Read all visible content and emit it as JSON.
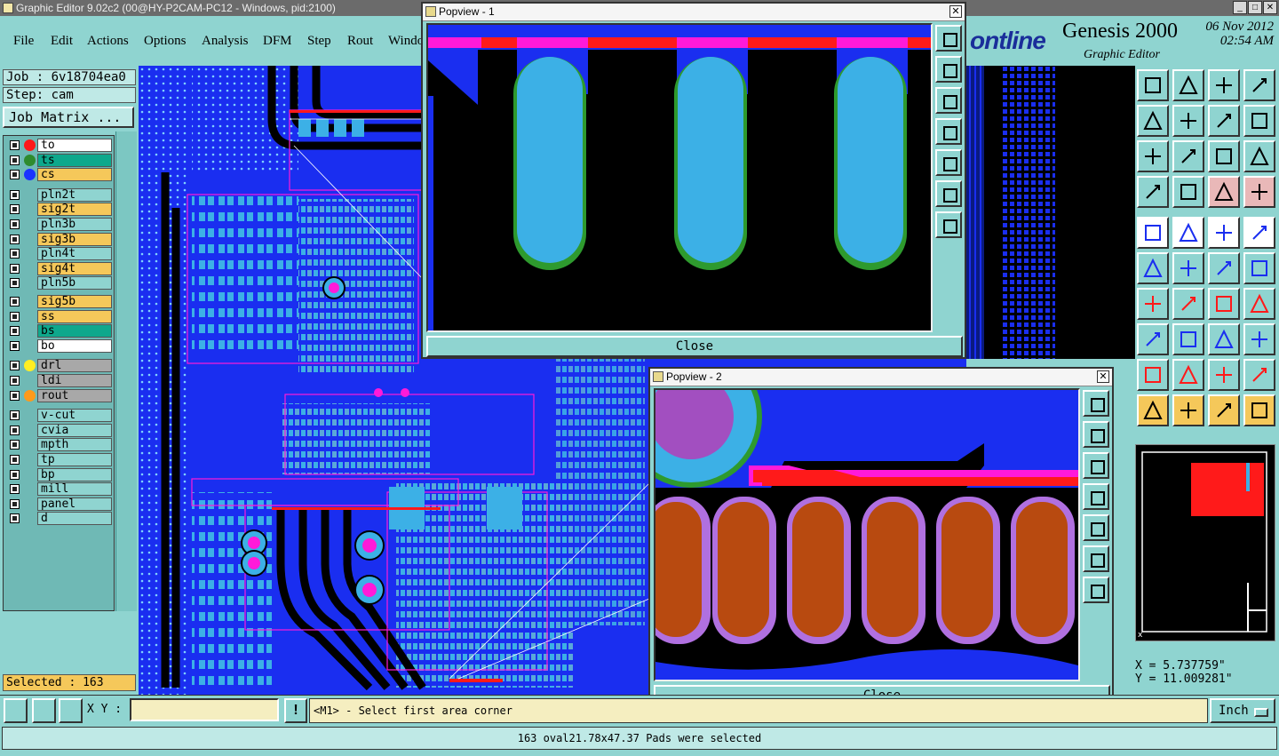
{
  "window": {
    "title": "Graphic Editor 9.02c2 (00@HY-P2CAM-PC12 - Windows, pid:2100)",
    "controls": [
      "_",
      "□",
      "✕"
    ]
  },
  "menu": [
    "File",
    "Edit",
    "Actions",
    "Options",
    "Analysis",
    "DFM",
    "Step",
    "Rout",
    "Windo"
  ],
  "brand": {
    "logo": "ontline",
    "product": "Genesis 2000",
    "date": "06 Nov 2012",
    "time": "02:54 AM",
    "subtitle": "Graphic Editor"
  },
  "job": {
    "job_label": "Job : 6v18704ea0",
    "step_label": "Step: cam",
    "matrix_button": "Job Matrix ..."
  },
  "layers": [
    {
      "name": "to",
      "color": "#ffffff",
      "dot": "#ff1a1a"
    },
    {
      "name": "ts",
      "color": "#0ea88c",
      "dot": "#2e8b2e"
    },
    {
      "name": "cs",
      "color": "#f5c85a",
      "dot": "#1a33ff"
    },
    {
      "name": "pln2t",
      "color": "#8fd4d0",
      "dot": ""
    },
    {
      "name": "sig2t",
      "color": "#f5c85a",
      "dot": ""
    },
    {
      "name": "pln3b",
      "color": "#8fd4d0",
      "dot": ""
    },
    {
      "name": "sig3b",
      "color": "#f5c85a",
      "dot": ""
    },
    {
      "name": "pln4t",
      "color": "#8fd4d0",
      "dot": ""
    },
    {
      "name": "sig4t",
      "color": "#f5c85a",
      "dot": ""
    },
    {
      "name": "pln5b",
      "color": "#8fd4d0",
      "dot": ""
    },
    {
      "name": "sig5b",
      "color": "#f5c85a",
      "dot": ""
    },
    {
      "name": "ss",
      "color": "#f5c85a",
      "dot": ""
    },
    {
      "name": "bs",
      "color": "#0ea88c",
      "dot": ""
    },
    {
      "name": "bo",
      "color": "#ffffff",
      "dot": ""
    },
    {
      "name": "drl",
      "color": "#a8a8a8",
      "dot": "#ffee22"
    },
    {
      "name": "ldi",
      "color": "#a8a8a8",
      "dot": ""
    },
    {
      "name": "rout",
      "color": "#a8a8a8",
      "dot": "#ff9a1a"
    },
    {
      "name": "v-cut",
      "color": "#8fd4d0",
      "dot": ""
    },
    {
      "name": "cvia",
      "color": "#8fd4d0",
      "dot": ""
    },
    {
      "name": "mpth",
      "color": "#8fd4d0",
      "dot": ""
    },
    {
      "name": "tp",
      "color": "#8fd4d0",
      "dot": ""
    },
    {
      "name": "bp",
      "color": "#8fd4d0",
      "dot": ""
    },
    {
      "name": "mill",
      "color": "#8fd4d0",
      "dot": ""
    },
    {
      "name": "panel",
      "color": "#8fd4d0",
      "dot": ""
    },
    {
      "name": "d",
      "color": "#8fd4d0",
      "dot": ""
    }
  ],
  "selected_label": "Selected : 163",
  "popview1": {
    "title": "Popview - 1",
    "close": "Close"
  },
  "popview2": {
    "title": "Popview - 2",
    "close": "Close"
  },
  "coords": {
    "x": "X =  5.737759\"",
    "y": "Y = 11.009281\""
  },
  "bottom": {
    "xy_label": "X Y :",
    "xy_value": "",
    "warn": "!",
    "prompt": "<M1> - Select first area corner",
    "units": "Inch"
  },
  "status": "163 oval21.78x47.37 Pads were selected",
  "colors": {
    "board_blue": "#1a2ef0",
    "pad_cyan": "#3cb0e6",
    "magenta": "#ff1ad9",
    "red": "#ff1a1a",
    "copper": "#b84a10",
    "green": "#2e9a2e",
    "panel": "#8fd4d0"
  }
}
